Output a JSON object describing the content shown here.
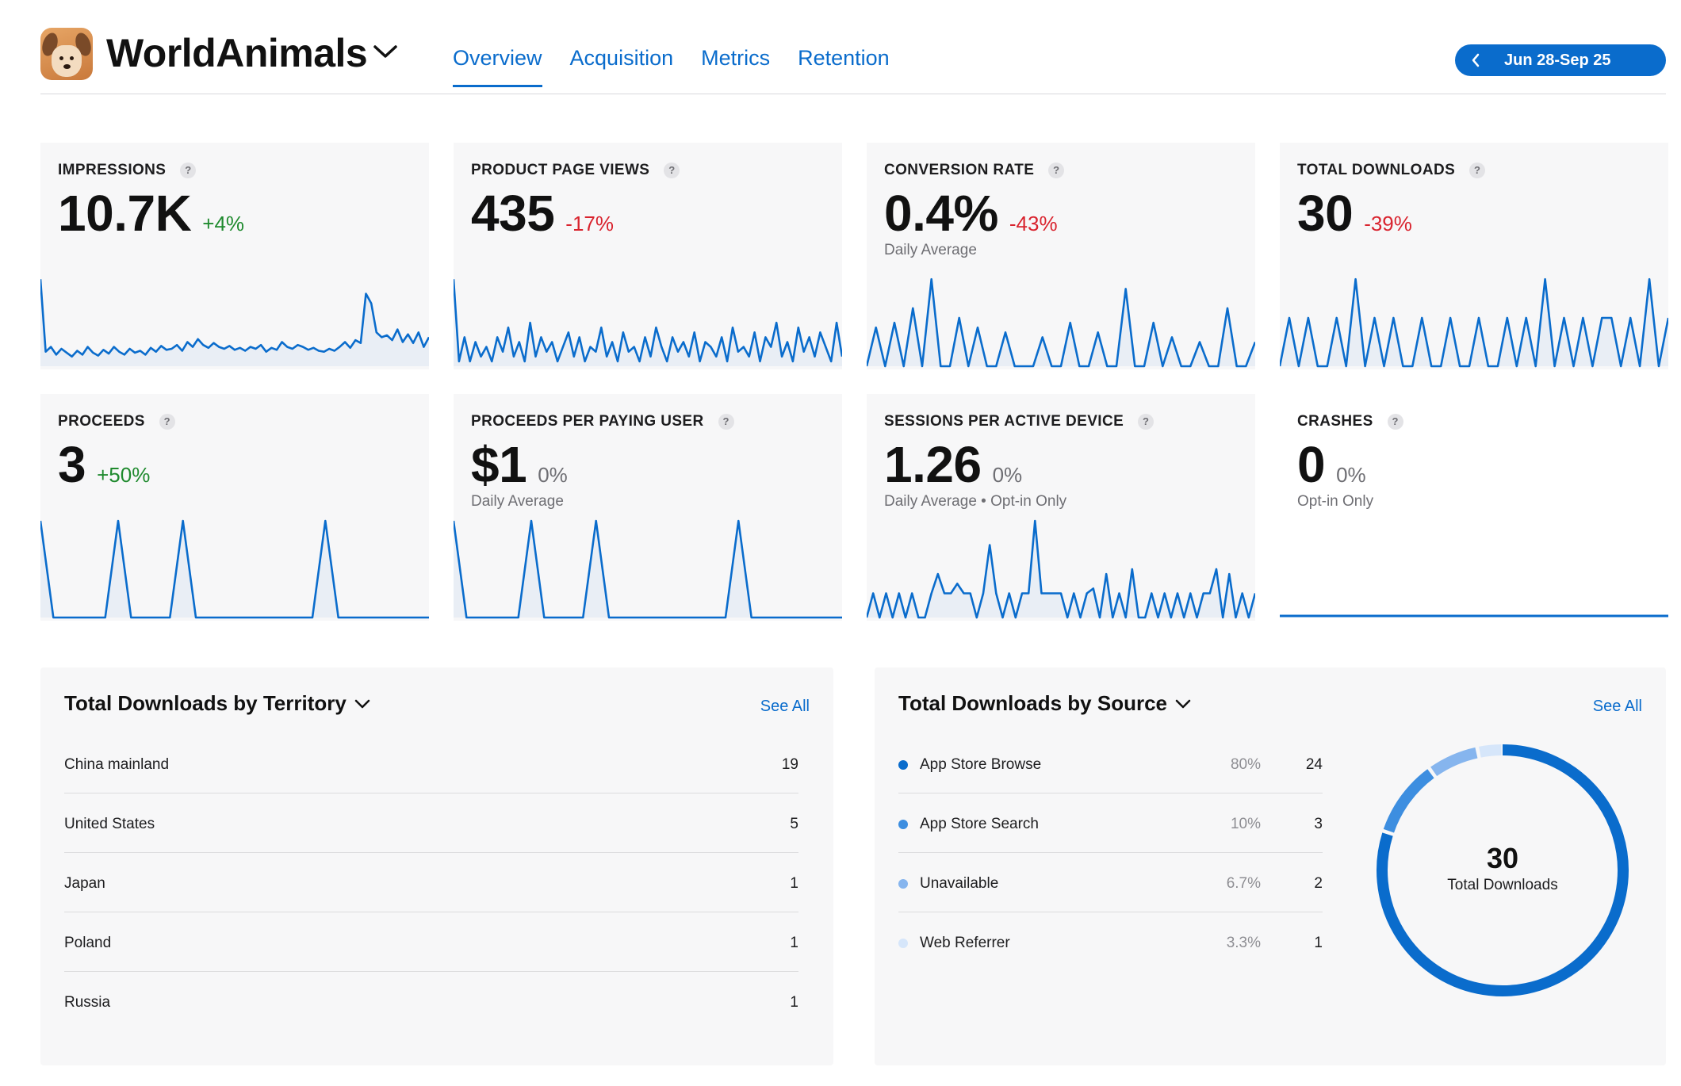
{
  "app": {
    "name": "WorldAnimals"
  },
  "tabs": [
    {
      "label": "Overview",
      "active": true
    },
    {
      "label": "Acquisition",
      "active": false
    },
    {
      "label": "Metrics",
      "active": false
    },
    {
      "label": "Retention",
      "active": false
    }
  ],
  "date_range": {
    "label": "Jun 28-Sep 25"
  },
  "help_glyph": "?",
  "metrics": [
    {
      "title": "IMPRESSIONS",
      "value": "10.7K",
      "change": "+4%",
      "trend": "up",
      "subtitle": ""
    },
    {
      "title": "PRODUCT PAGE VIEWS",
      "value": "435",
      "change": "-17%",
      "trend": "down",
      "subtitle": ""
    },
    {
      "title": "CONVERSION RATE",
      "value": "0.4%",
      "change": "-43%",
      "trend": "down",
      "subtitle": "Daily Average"
    },
    {
      "title": "TOTAL DOWNLOADS",
      "value": "30",
      "change": "-39%",
      "trend": "down",
      "subtitle": ""
    },
    {
      "title": "PROCEEDS",
      "value": "3",
      "change": "+50%",
      "trend": "up",
      "subtitle": ""
    },
    {
      "title": "PROCEEDS PER PAYING USER",
      "value": "$1",
      "change": "0%",
      "trend": "flat",
      "subtitle": "Daily Average"
    },
    {
      "title": "SESSIONS PER ACTIVE DEVICE",
      "value": "1.26",
      "change": "0%",
      "trend": "flat",
      "subtitle": "Daily Average • Opt-in Only"
    },
    {
      "title": "CRASHES",
      "value": "0",
      "change": "0%",
      "trend": "flat",
      "subtitle": "Opt-in Only"
    }
  ],
  "sparkline_series": {
    "impressions": [
      0.9,
      0.15,
      0.2,
      0.12,
      0.18,
      0.14,
      0.1,
      0.16,
      0.12,
      0.2,
      0.14,
      0.11,
      0.17,
      0.13,
      0.2,
      0.15,
      0.12,
      0.18,
      0.14,
      0.16,
      0.12,
      0.19,
      0.15,
      0.21,
      0.17,
      0.18,
      0.22,
      0.16,
      0.25,
      0.2,
      0.28,
      0.22,
      0.19,
      0.24,
      0.2,
      0.18,
      0.21,
      0.17,
      0.19,
      0.16,
      0.2,
      0.18,
      0.22,
      0.15,
      0.19,
      0.17,
      0.25,
      0.2,
      0.18,
      0.22,
      0.2,
      0.17,
      0.19,
      0.16,
      0.15,
      0.18,
      0.16,
      0.2,
      0.25,
      0.19,
      0.27,
      0.24,
      0.75,
      0.65,
      0.35,
      0.3,
      0.32,
      0.27,
      0.38,
      0.25,
      0.33,
      0.24,
      0.35,
      0.2,
      0.3
    ],
    "page_views": [
      0.9,
      0.05,
      0.3,
      0.05,
      0.25,
      0.1,
      0.2,
      0.05,
      0.3,
      0.15,
      0.4,
      0.1,
      0.25,
      0.05,
      0.45,
      0.1,
      0.3,
      0.15,
      0.25,
      0.05,
      0.2,
      0.35,
      0.1,
      0.3,
      0.05,
      0.2,
      0.15,
      0.4,
      0.1,
      0.25,
      0.05,
      0.35,
      0.15,
      0.2,
      0.05,
      0.3,
      0.1,
      0.4,
      0.2,
      0.05,
      0.3,
      0.15,
      0.25,
      0.1,
      0.35,
      0.05,
      0.25,
      0.2,
      0.1,
      0.3,
      0.05,
      0.4,
      0.15,
      0.2,
      0.1,
      0.35,
      0.05,
      0.3,
      0.2,
      0.45,
      0.1,
      0.25,
      0.05,
      0.4,
      0.15,
      0.3,
      0.1,
      0.35,
      0.2,
      0.05,
      0.45,
      0.1
    ],
    "conversion": [
      0,
      0.4,
      0,
      0.45,
      0,
      0.6,
      0,
      0.9,
      0,
      0,
      0.5,
      0,
      0.4,
      0,
      0,
      0.35,
      0,
      0,
      0,
      0.3,
      0,
      0,
      0.45,
      0,
      0,
      0.35,
      0,
      0,
      0.8,
      0,
      0,
      0.45,
      0,
      0.3,
      0,
      0,
      0.25,
      0,
      0,
      0.6,
      0,
      0,
      0.25
    ],
    "downloads": [
      0,
      0.5,
      0,
      0.5,
      0,
      0,
      0.5,
      0,
      0.9,
      0,
      0.5,
      0,
      0.5,
      0,
      0,
      0.5,
      0,
      0,
      0.5,
      0,
      0,
      0.5,
      0,
      0,
      0.5,
      0,
      0.5,
      0,
      0.9,
      0,
      0.5,
      0,
      0.5,
      0,
      0.5,
      0.5,
      0,
      0.5,
      0,
      0.9,
      0,
      0.5
    ],
    "proceeds": [
      1,
      0,
      0,
      0,
      0,
      0,
      1,
      0,
      0,
      0,
      0,
      1,
      0,
      0,
      0,
      0,
      0,
      0,
      0,
      0,
      0,
      0,
      1,
      0,
      0,
      0,
      0,
      0,
      0,
      0,
      0
    ],
    "proceeds_per_user": [
      1,
      0,
      0,
      0,
      0,
      0,
      1,
      0,
      0,
      0,
      0,
      1,
      0,
      0,
      0,
      0,
      0,
      0,
      0,
      0,
      0,
      0,
      1,
      0,
      0,
      0,
      0,
      0,
      0,
      0,
      0
    ],
    "sessions": [
      0,
      0.25,
      0,
      0.25,
      0,
      0.25,
      0,
      0.25,
      0,
      0,
      0.25,
      0.45,
      0.25,
      0.25,
      0.35,
      0.25,
      0.25,
      0,
      0.25,
      0.75,
      0.25,
      0,
      0.25,
      0,
      0.25,
      0.25,
      1,
      0.25,
      0.25,
      0.25,
      0.25,
      0,
      0.25,
      0,
      0.25,
      0.3,
      0,
      0.45,
      0,
      0.25,
      0,
      0.5,
      0,
      0,
      0.25,
      0,
      0.25,
      0,
      0.25,
      0,
      0.25,
      0,
      0.25,
      0.25,
      0.5,
      0,
      0.45,
      0,
      0.25,
      0,
      0.25
    ],
    "crashes": [
      0,
      0,
      0,
      0,
      0,
      0,
      0,
      0,
      0,
      0
    ]
  },
  "territory": {
    "title": "Total Downloads by Territory",
    "see_all": "See All",
    "rows": [
      {
        "name": "China mainland",
        "value": "19"
      },
      {
        "name": "United States",
        "value": "5"
      },
      {
        "name": "Japan",
        "value": "1"
      },
      {
        "name": "Poland",
        "value": "1"
      },
      {
        "name": "Russia",
        "value": "1"
      }
    ]
  },
  "source": {
    "title": "Total Downloads by Source",
    "see_all": "See All",
    "rows": [
      {
        "name": "App Store Browse",
        "pct": "80%",
        "value": "24",
        "color": "#0a6ccc"
      },
      {
        "name": "App Store Search",
        "pct": "10%",
        "value": "3",
        "color": "#3d8ee0"
      },
      {
        "name": "Unavailable",
        "pct": "6.7%",
        "value": "2",
        "color": "#86b5ee"
      },
      {
        "name": "Web Referrer",
        "pct": "3.3%",
        "value": "1",
        "color": "#d6e6fa"
      }
    ],
    "donut_total": "30",
    "donut_label": "Total Downloads"
  },
  "colors": {
    "accent": "#0a6ccc",
    "positive": "#1f8a2e",
    "negative": "#d9232e"
  }
}
